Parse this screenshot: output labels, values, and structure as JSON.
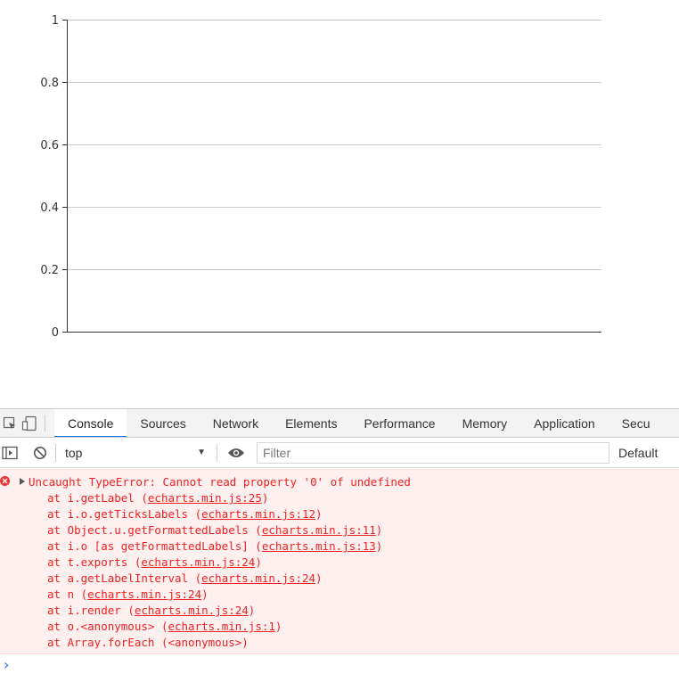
{
  "chart_data": {
    "type": "line",
    "title": "",
    "xlabel": "",
    "ylabel": "",
    "categories": [],
    "series": [],
    "ylim": [
      0,
      1
    ],
    "yticks": [
      "0",
      "0.2",
      "0.4",
      "0.6",
      "0.8",
      "1"
    ],
    "grid": true
  },
  "devtools": {
    "tabs": [
      {
        "label": "Console",
        "active": true
      },
      {
        "label": "Sources"
      },
      {
        "label": "Network"
      },
      {
        "label": "Elements"
      },
      {
        "label": "Performance"
      },
      {
        "label": "Memory"
      },
      {
        "label": "Application"
      },
      {
        "label": "Secu"
      }
    ],
    "toolbar": {
      "context": "top",
      "filter_placeholder": "Filter",
      "levels": "Default"
    },
    "error": {
      "message": "Uncaught TypeError: Cannot read property '0' of undefined",
      "frames": [
        {
          "fn": "at i.getLabel",
          "src": "echarts.min.js:25"
        },
        {
          "fn": "at i.o.getTicksLabels",
          "src": "echarts.min.js:12"
        },
        {
          "fn": "at Object.u.getFormattedLabels",
          "src": "echarts.min.js:11"
        },
        {
          "fn": "at i.o [as getFormattedLabels]",
          "src": "echarts.min.js:13"
        },
        {
          "fn": "at t.exports",
          "src": "echarts.min.js:24"
        },
        {
          "fn": "at a.getLabelInterval",
          "src": "echarts.min.js:24"
        },
        {
          "fn": "at n",
          "src": "echarts.min.js:24"
        },
        {
          "fn": "at i.render",
          "src": "echarts.min.js:24"
        },
        {
          "fn": "at o.<anonymous>",
          "src": "echarts.min.js:1"
        },
        {
          "fn": "at Array.forEach",
          "src": "<anonymous>",
          "plain": true
        }
      ]
    },
    "prompt_glyph": "›",
    "colors": {
      "error_text": "#ee2222",
      "error_bg": "#fff0f0",
      "accent": "#1a73e8",
      "prompt": "#1a73e8"
    }
  }
}
